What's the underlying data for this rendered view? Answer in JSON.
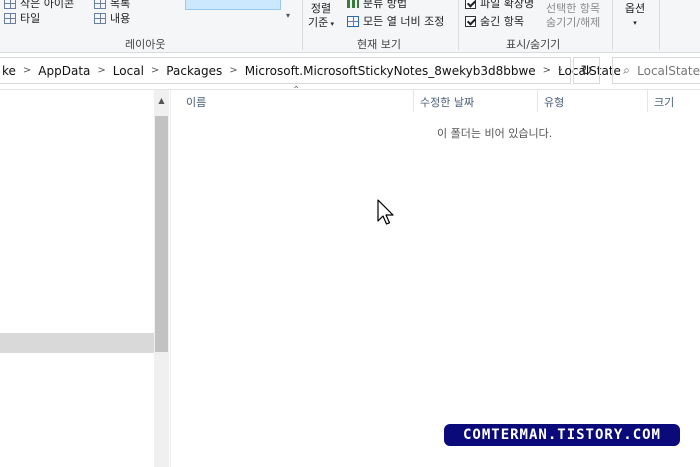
{
  "ribbon": {
    "layout": {
      "item_top_right": "작은 아이콘",
      "item_tile": "타일",
      "item_list": "목록",
      "item_content": "내용",
      "group_label": "레이아웃"
    },
    "current_view": {
      "sort_line1": "정렬",
      "sort_line2": "기준",
      "group_by": "분류 방법",
      "fit_columns": "모든 열 너비 조정",
      "group_label": "현재 보기"
    },
    "show_hide": {
      "file_ext": "파일 확장명",
      "hidden_items": "숨긴 항목",
      "hide_selected_line1": "선택한 항목",
      "hide_selected_line2": "숨기기/해제",
      "group_label": "표시/숨기기"
    },
    "options": {
      "label": "옵션"
    }
  },
  "address": {
    "crumbs": [
      "ke",
      "AppData",
      "Local",
      "Packages",
      "Microsoft.MicrosoftStickyNotes_8wekyb3d8bbwe",
      "LocalState"
    ],
    "search_placeholder": "LocalState"
  },
  "columns": {
    "name": "이름",
    "modified": "수정한 날짜",
    "type": "유형",
    "size": "크기"
  },
  "empty_message": "이 폴더는 비어 있습니다.",
  "watermark": "COMTERMAN.TISTORY.COM",
  "colors": {
    "accent": "#0078d7",
    "watermark_bg": "#0a0a7a",
    "selection": "#d9d9d9"
  }
}
